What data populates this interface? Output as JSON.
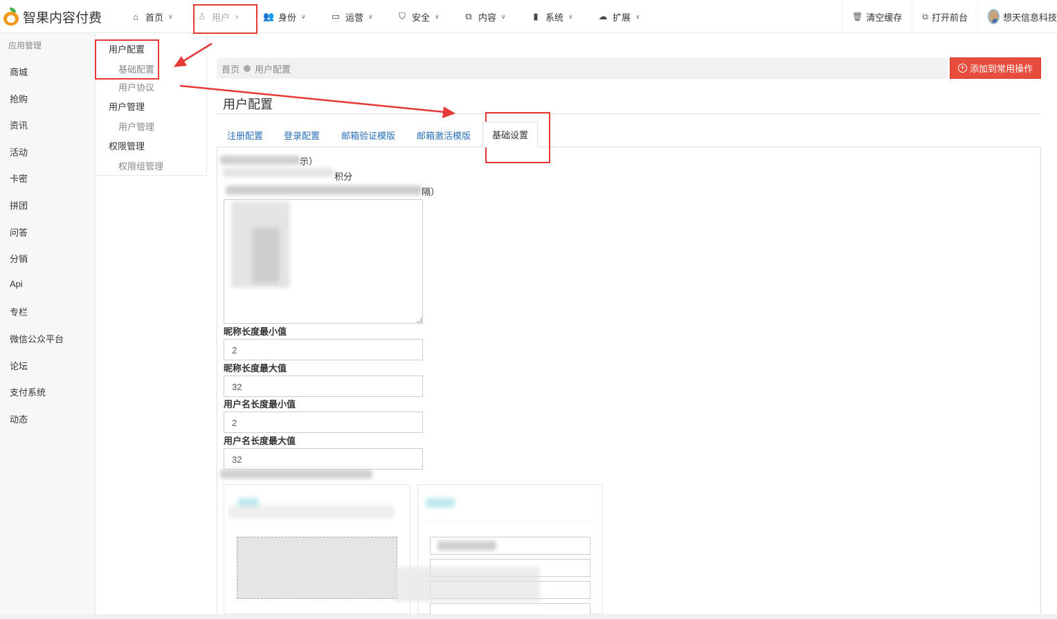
{
  "app": {
    "title": "智果内容付费"
  },
  "topnav": {
    "items": [
      {
        "label": "首页",
        "icon": "home-icon"
      },
      {
        "label": "用户",
        "icon": "user-icon"
      },
      {
        "label": "身份",
        "icon": "users-icon"
      },
      {
        "label": "运营",
        "icon": "monitor-icon"
      },
      {
        "label": "安全",
        "icon": "shield-icon"
      },
      {
        "label": "内容",
        "icon": "copy-icon"
      },
      {
        "label": "系统",
        "icon": "book-icon"
      },
      {
        "label": "扩展",
        "icon": "cloud-icon"
      }
    ],
    "clear_cache": "清空缓存",
    "open_frontend": "打开前台",
    "username": "想天信息科技"
  },
  "sidebar": {
    "header": "应用管理",
    "items": [
      "商城",
      "抢购",
      "资讯",
      "活动",
      "卡密",
      "拼团",
      "问答",
      "分销",
      "Api",
      "专栏",
      "微信公众平台",
      "论坛",
      "支付系统",
      "动态"
    ]
  },
  "submenu": {
    "groups": [
      {
        "title": "用户配置",
        "items": [
          "基础配置",
          "用户协议"
        ]
      },
      {
        "title": "用户管理",
        "items": [
          "用户管理"
        ]
      },
      {
        "title": "权限管理",
        "items": [
          "权限组管理"
        ]
      }
    ]
  },
  "breadcrumb": {
    "home": "首页",
    "current": "用户配置"
  },
  "add_button": "添加到常用操作",
  "page_title": "用户配置",
  "tabs": [
    "注册配置",
    "登录配置",
    "邮箱验证模版",
    "邮箱激活模版",
    "基础设置"
  ],
  "form": {
    "fragment1": "示）",
    "fragment2": "积分",
    "fragment3": "隔）",
    "fields": [
      {
        "label": "昵称长度最小值",
        "value": "2"
      },
      {
        "label": "昵称长度最大值",
        "value": "32"
      },
      {
        "label": "用户名长度最小值",
        "value": "2"
      },
      {
        "label": "用户名长度最大值",
        "value": "32"
      }
    ]
  },
  "colors": {
    "accent_red": "#e74c3c",
    "link_blue": "#2a6fb6",
    "annotation_red": "#e53935"
  }
}
